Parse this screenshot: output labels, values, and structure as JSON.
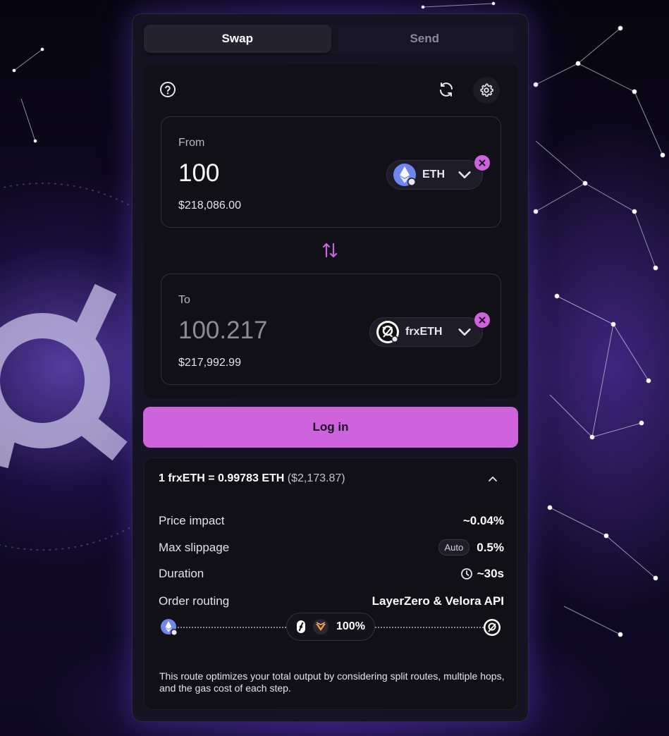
{
  "tabs": [
    {
      "label": "Swap",
      "active": true
    },
    {
      "label": "Send",
      "active": false
    }
  ],
  "colors": {
    "accent": "#cf62dd",
    "panel": "#16141f"
  },
  "toolbar": {
    "help_icon": "help-circle-icon",
    "refresh_icon": "refresh-icon",
    "settings_icon": "gear-icon"
  },
  "from": {
    "label": "From",
    "amount": "100",
    "usd": "$218,086.00",
    "token": "ETH"
  },
  "to": {
    "label": "To",
    "amount": "100.217",
    "usd": "$217,992.99",
    "token": "frxETH"
  },
  "login_label": "Log in",
  "details": {
    "rate": "1 frxETH = 0.99783 ETH",
    "rate_usd": "($2,173.87)",
    "rows": [
      {
        "label": "Price impact",
        "value": "~0.04%"
      },
      {
        "label": "Max slippage",
        "badge": "Auto",
        "value": "0.5%"
      },
      {
        "label": "Duration",
        "value": "~30s"
      },
      {
        "label": "Order routing",
        "value": "LayerZero & Velora API"
      }
    ],
    "route_percent": "100%",
    "note": "This route optimizes your total output by considering split routes, multiple hops, and the gas cost of each step."
  }
}
